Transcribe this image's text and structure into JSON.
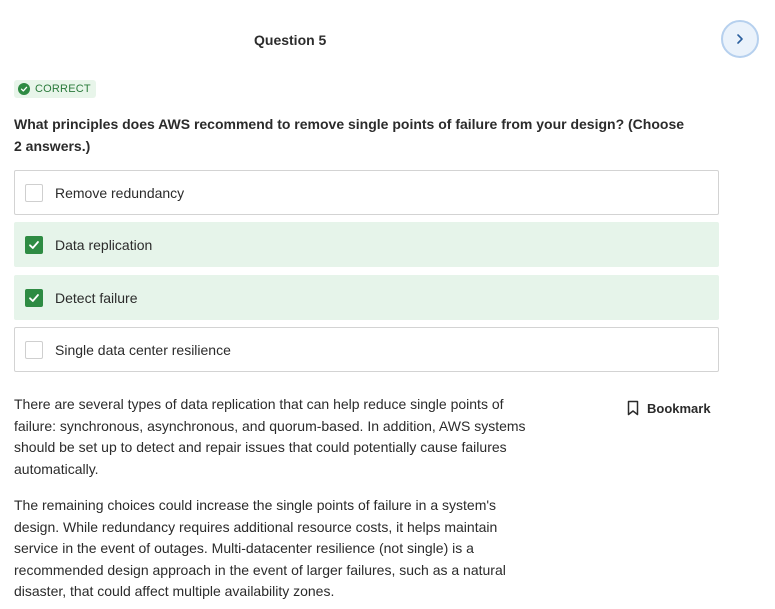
{
  "header": {
    "question_title": "Question 5",
    "next_icon": "chevron-right-icon"
  },
  "status": {
    "label": "CORRECT",
    "icon": "check-circle-icon",
    "color": "#2e8b43"
  },
  "question": {
    "prompt": "What principles does AWS recommend to remove single points of failure from your design? (Choose 2 answers.)"
  },
  "options": [
    {
      "label": "Remove redundancy",
      "checked": false
    },
    {
      "label": "Data replication",
      "checked": true
    },
    {
      "label": "Detect failure",
      "checked": true
    },
    {
      "label": "Single data center resilience",
      "checked": false
    }
  ],
  "explanation": {
    "paragraph_1": "There are several types of data replication that can help reduce single points of failure: synchronous, asynchronous, and quorum-based. In addition, AWS systems should be set up to detect and repair issues that could potentially cause failures automatically.",
    "paragraph_2": "The remaining choices could increase the single points of failure in a system's design. While redundancy requires additional resource costs, it helps maintain service in the event of outages. Multi-datacenter resilience (not single) is a recommended design approach in the event of larger failures, such as a natural disaster, that could affect multiple availability zones."
  },
  "bookmark": {
    "label": "Bookmark",
    "icon": "bookmark-icon"
  },
  "colors": {
    "correct_green": "#2e8b43",
    "selected_bg": "#e6f4ea",
    "next_button_bg": "#eaf2fb"
  }
}
